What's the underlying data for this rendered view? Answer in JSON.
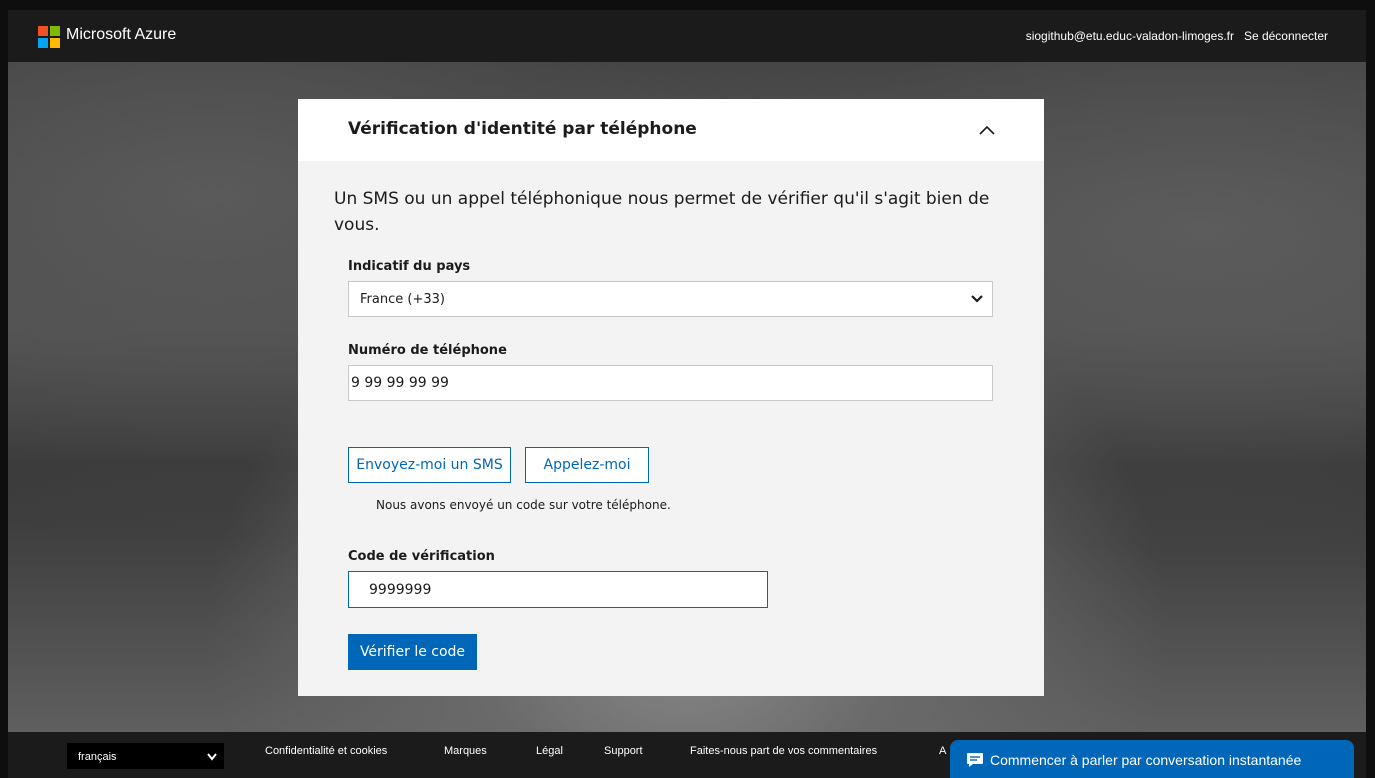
{
  "header": {
    "brand": "Microsoft Azure",
    "user_email": "siogithub@etu.educ-valadon-limoges.fr",
    "signout_label": "Se déconnecter",
    "logo_colors": [
      "#f25022",
      "#7fba00",
      "#00a4ef",
      "#ffb900"
    ]
  },
  "card": {
    "title": "Vérification d'identité par téléphone",
    "collapse_icon": "chevron-up-icon",
    "intro": "Un SMS ou un appel téléphonique nous permet de vérifier qu'il s'agit bien de vous.",
    "country_label": "Indicatif du pays",
    "country_value": "France (+33)",
    "phone_label": "Numéro de téléphone",
    "phone_value": "9 99 99 99 99",
    "sms_button": "Envoyez-moi un SMS",
    "call_button": "Appelez-moi",
    "sent_message": "Nous avons envoyé un code sur votre téléphone.",
    "code_label": "Code de vérification",
    "code_value": "9999999",
    "verify_button": "Vérifier le code"
  },
  "footer": {
    "language": "français",
    "links": [
      "Confidentialité et cookies",
      "Marques",
      "Légal",
      "Support",
      "Faites-nous part de vos commentaires",
      "A"
    ],
    "chat_label": "Commencer à parler par conversation instantanée"
  },
  "colors": {
    "accent": "#0067b8",
    "topbar": "#1b1b1b",
    "card_bg": "#f3f3f3"
  }
}
